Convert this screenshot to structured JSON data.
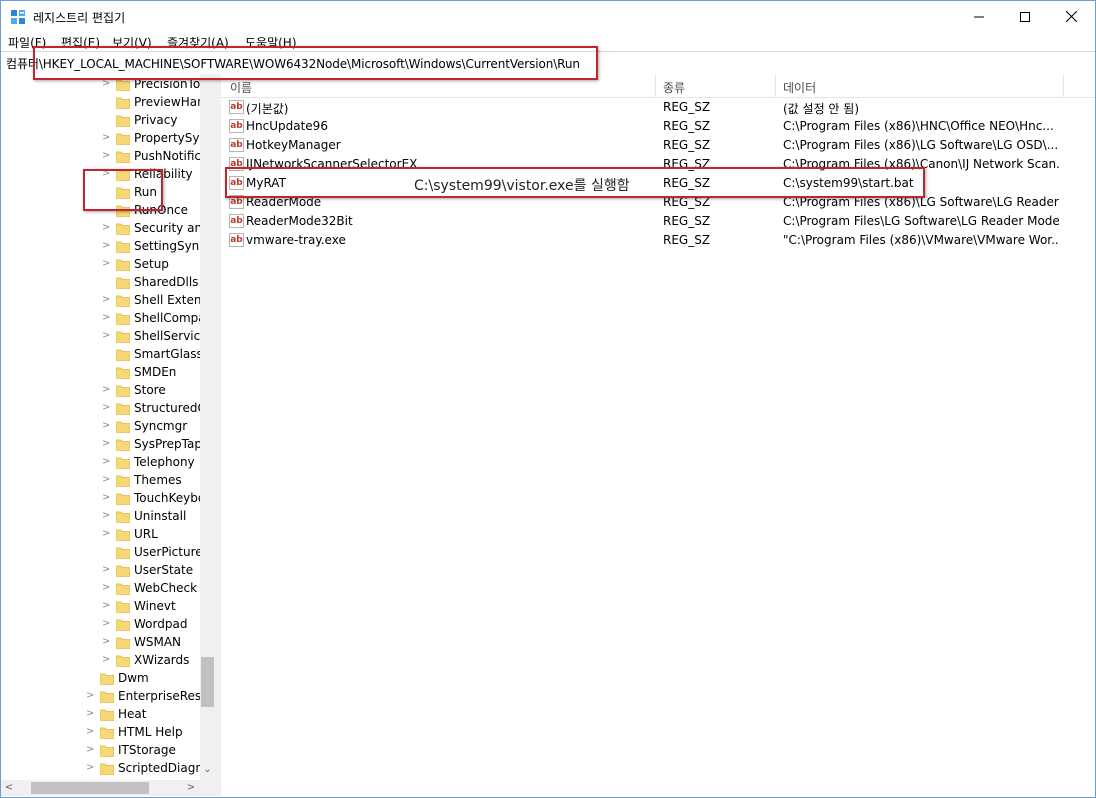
{
  "window": {
    "title": "레지스트리 편집기"
  },
  "menu": [
    "파일(F)",
    "편집(E)",
    "보기(V)",
    "즐겨찾기(A)",
    "도움말(H)"
  ],
  "address": {
    "path": "컴퓨터\\HKEY_LOCAL_MACHINE\\SOFTWARE\\WOW6432Node\\Microsoft\\Windows\\CurrentVersion\\Run"
  },
  "tree": {
    "items": [
      {
        "label": "PrecisionTou",
        "expandable": true
      },
      {
        "label": "PreviewHand",
        "expandable": false
      },
      {
        "label": "Privacy",
        "expandable": false
      },
      {
        "label": "PropertySyst",
        "expandable": true
      },
      {
        "label": "PushNotifica",
        "expandable": true
      },
      {
        "label": "Reliability",
        "expandable": true
      },
      {
        "label": "Run",
        "expandable": false
      },
      {
        "label": "RunOnce",
        "expandable": false
      },
      {
        "label": "Security and",
        "expandable": true
      },
      {
        "label": "SettingSync",
        "expandable": true
      },
      {
        "label": "Setup",
        "expandable": true
      },
      {
        "label": "SharedDlls",
        "expandable": false
      },
      {
        "label": "Shell Extens",
        "expandable": true
      },
      {
        "label": "ShellCompa",
        "expandable": true
      },
      {
        "label": "ShellService",
        "expandable": true
      },
      {
        "label": "SmartGlass",
        "expandable": false
      },
      {
        "label": "SMDEn",
        "expandable": false
      },
      {
        "label": "Store",
        "expandable": true
      },
      {
        "label": "StructuredQ",
        "expandable": true
      },
      {
        "label": "Syncmgr",
        "expandable": true
      },
      {
        "label": "SysPrepTapi",
        "expandable": true
      },
      {
        "label": "Telephony",
        "expandable": true
      },
      {
        "label": "Themes",
        "expandable": true
      },
      {
        "label": "TouchKeybo",
        "expandable": true
      },
      {
        "label": "Uninstall",
        "expandable": true
      },
      {
        "label": "URL",
        "expandable": true
      },
      {
        "label": "UserPictureC",
        "expandable": false
      },
      {
        "label": "UserState",
        "expandable": true
      },
      {
        "label": "WebCheck",
        "expandable": true
      },
      {
        "label": "Winevt",
        "expandable": true
      },
      {
        "label": "Wordpad",
        "expandable": true
      },
      {
        "label": "WSMAN",
        "expandable": true
      },
      {
        "label": "XWizards",
        "expandable": true
      }
    ],
    "parent_items": [
      {
        "label": "Dwm",
        "expandable": false
      },
      {
        "label": "EnterpriseResou",
        "expandable": true
      },
      {
        "label": "Heat",
        "expandable": true
      },
      {
        "label": "HTML Help",
        "expandable": true
      },
      {
        "label": "ITStorage",
        "expandable": true
      },
      {
        "label": "ScriptedDiagnc",
        "expandable": true
      }
    ]
  },
  "list": {
    "headers": {
      "name": "이름",
      "type": "종류",
      "data": "데이터"
    },
    "rows": [
      {
        "name": "(기본값)",
        "type": "REG_SZ",
        "data": "(값 설정 안 됨)"
      },
      {
        "name": "HncUpdate96",
        "type": "REG_SZ",
        "data": "C:\\Program Files (x86)\\HNC\\Office NEO\\Hnc..."
      },
      {
        "name": "HotkeyManager",
        "type": "REG_SZ",
        "data": "C:\\Program Files (x86)\\LG Software\\LG OSD\\..."
      },
      {
        "name": "IJNetworkScannerSelectorEX",
        "type": "REG_SZ",
        "data": "C:\\Program Files (x86)\\Canon\\IJ Network Scan..."
      },
      {
        "name": "MyRAT",
        "type": "REG_SZ",
        "data": "C:\\system99\\start.bat"
      },
      {
        "name": "ReaderMode",
        "type": "REG_SZ",
        "data": "C:\\Program Files (x86)\\LG Software\\LG Reader ..."
      },
      {
        "name": "ReaderMode32Bit",
        "type": "REG_SZ",
        "data": "C:\\Program Files\\LG Software\\LG Reader Mode..."
      },
      {
        "name": "vmware-tray.exe",
        "type": "REG_SZ",
        "data": "\"C:\\Program Files (x86)\\VMware\\VMware Wor..."
      }
    ]
  },
  "annotation": {
    "text": "C:\\system99\\vistor.exe를 실행함"
  },
  "colors": {
    "highlight_box": "#c0262d",
    "folder": "#f8d775",
    "window_border": "#6f9bd1"
  }
}
